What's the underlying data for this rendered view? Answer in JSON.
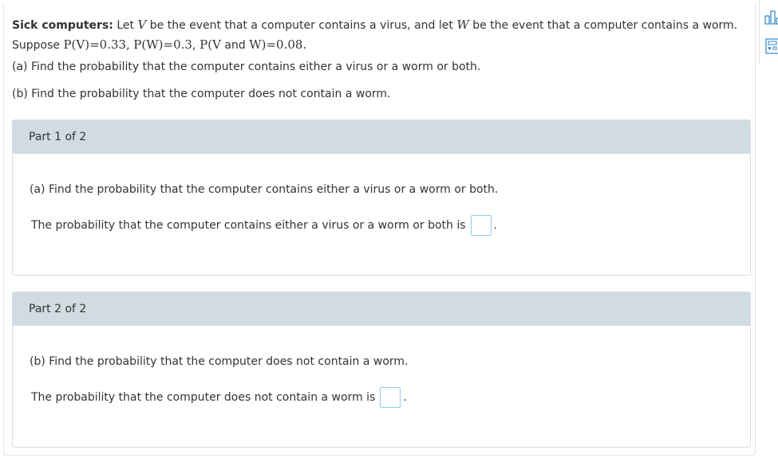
{
  "problem": {
    "title": "Sick computers:",
    "intro_1": "Let",
    "var_v": "V",
    "intro_2": "be the event that a computer contains a virus, and let",
    "var_w": "W",
    "intro_3": "be the event that a computer contains a worm.",
    "suppose": "Suppose",
    "pv": "P(V)=0.33,",
    "pw": "P(W)=0.3,",
    "pvw_a": "P(V",
    "pvw_and": "and",
    "pvw_b": "W)=0.08."
  },
  "questions": {
    "a": "(a) Find the probability that the computer contains either a virus or a worm or both.",
    "b": "(b) Find the probability that the computer does not contain a worm."
  },
  "parts": [
    {
      "header": "Part 1 of 2",
      "question": "(a) Find the probability that the computer contains either a virus or a worm or both.",
      "answer_prompt": "The probability that the computer contains either a virus or a worm or both is",
      "answer_value": ""
    },
    {
      "header": "Part 2 of 2",
      "question": "(b) Find the probability that the computer does not contain a worm.",
      "answer_prompt": "The probability that the computer does not contain a worm is",
      "answer_value": ""
    }
  ],
  "punctuation": ".",
  "tools": [
    "bar-chart-icon",
    "calculator-icon"
  ],
  "colors": {
    "part_header_bg": "#d0dce1",
    "answer_border": "#8fcbf0",
    "tool_icon": "#3a8fc9"
  }
}
